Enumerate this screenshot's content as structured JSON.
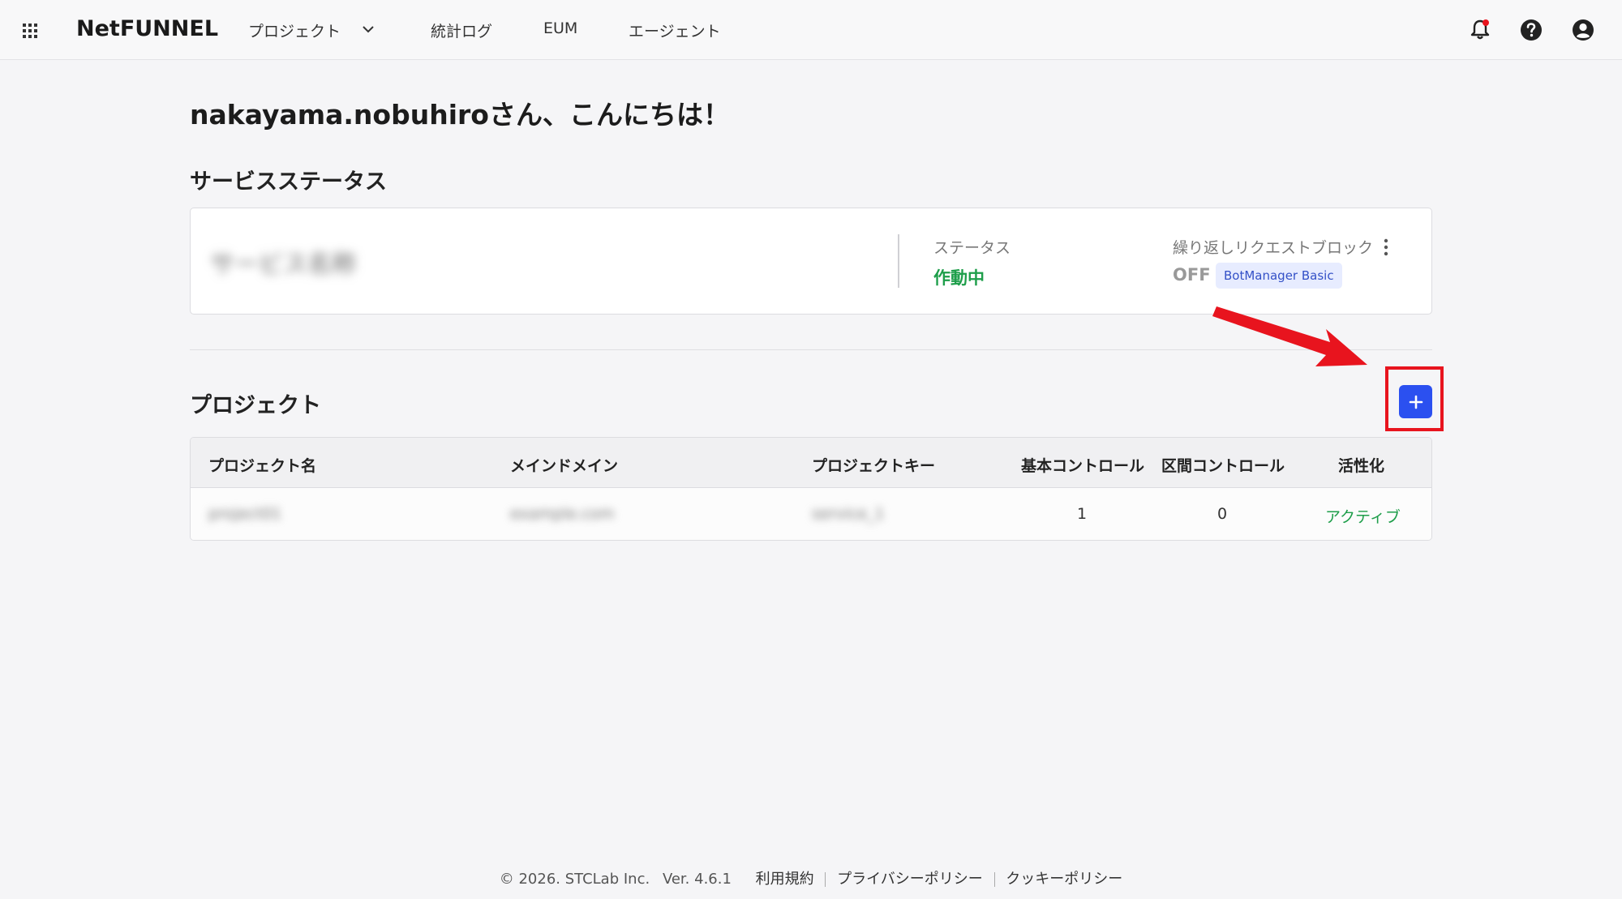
{
  "header": {
    "logo": "NetFUNNEL",
    "nav": {
      "project": "プロジェクト",
      "stats_log": "統計ログ",
      "eum": "EUM",
      "agent": "エージェント"
    },
    "icons": [
      "apps-grid-icon",
      "bell-icon",
      "help-icon",
      "account-icon",
      "chevron-down-icon"
    ]
  },
  "main": {
    "greeting": "nakayama.nobuhiroさん、こんにちは！",
    "service_status": {
      "title": "サービスステータス",
      "service_name": "サービス名称",
      "status_label": "ステータス",
      "status_value": "作動中",
      "repeat_block_label": "繰り返しリクエストブロック",
      "repeat_block_value": "OFF",
      "badge": "BotManager Basic"
    },
    "projects": {
      "title": "プロジェクト",
      "columns": [
        "プロジェクト名",
        "メインドメイン",
        "プロジェクトキー",
        "基本コントロール",
        "区間コントロール",
        "活性化"
      ],
      "rows": [
        {
          "name": "project01",
          "domain": "example.com",
          "key": "service_1",
          "basic_control": "1",
          "section_control": "0",
          "activation": "アクティブ"
        }
      ]
    }
  },
  "footer": {
    "copyright": "© 2026. STCLab Inc.",
    "version": "Ver. 4.6.1",
    "terms": "利用規約",
    "privacy": "プライバシーポリシー",
    "cookie": "クッキーポリシー"
  },
  "colors": {
    "accent": "#2b50f0",
    "active_green": "#1e9e4a",
    "highlight_red": "#e8141e"
  }
}
